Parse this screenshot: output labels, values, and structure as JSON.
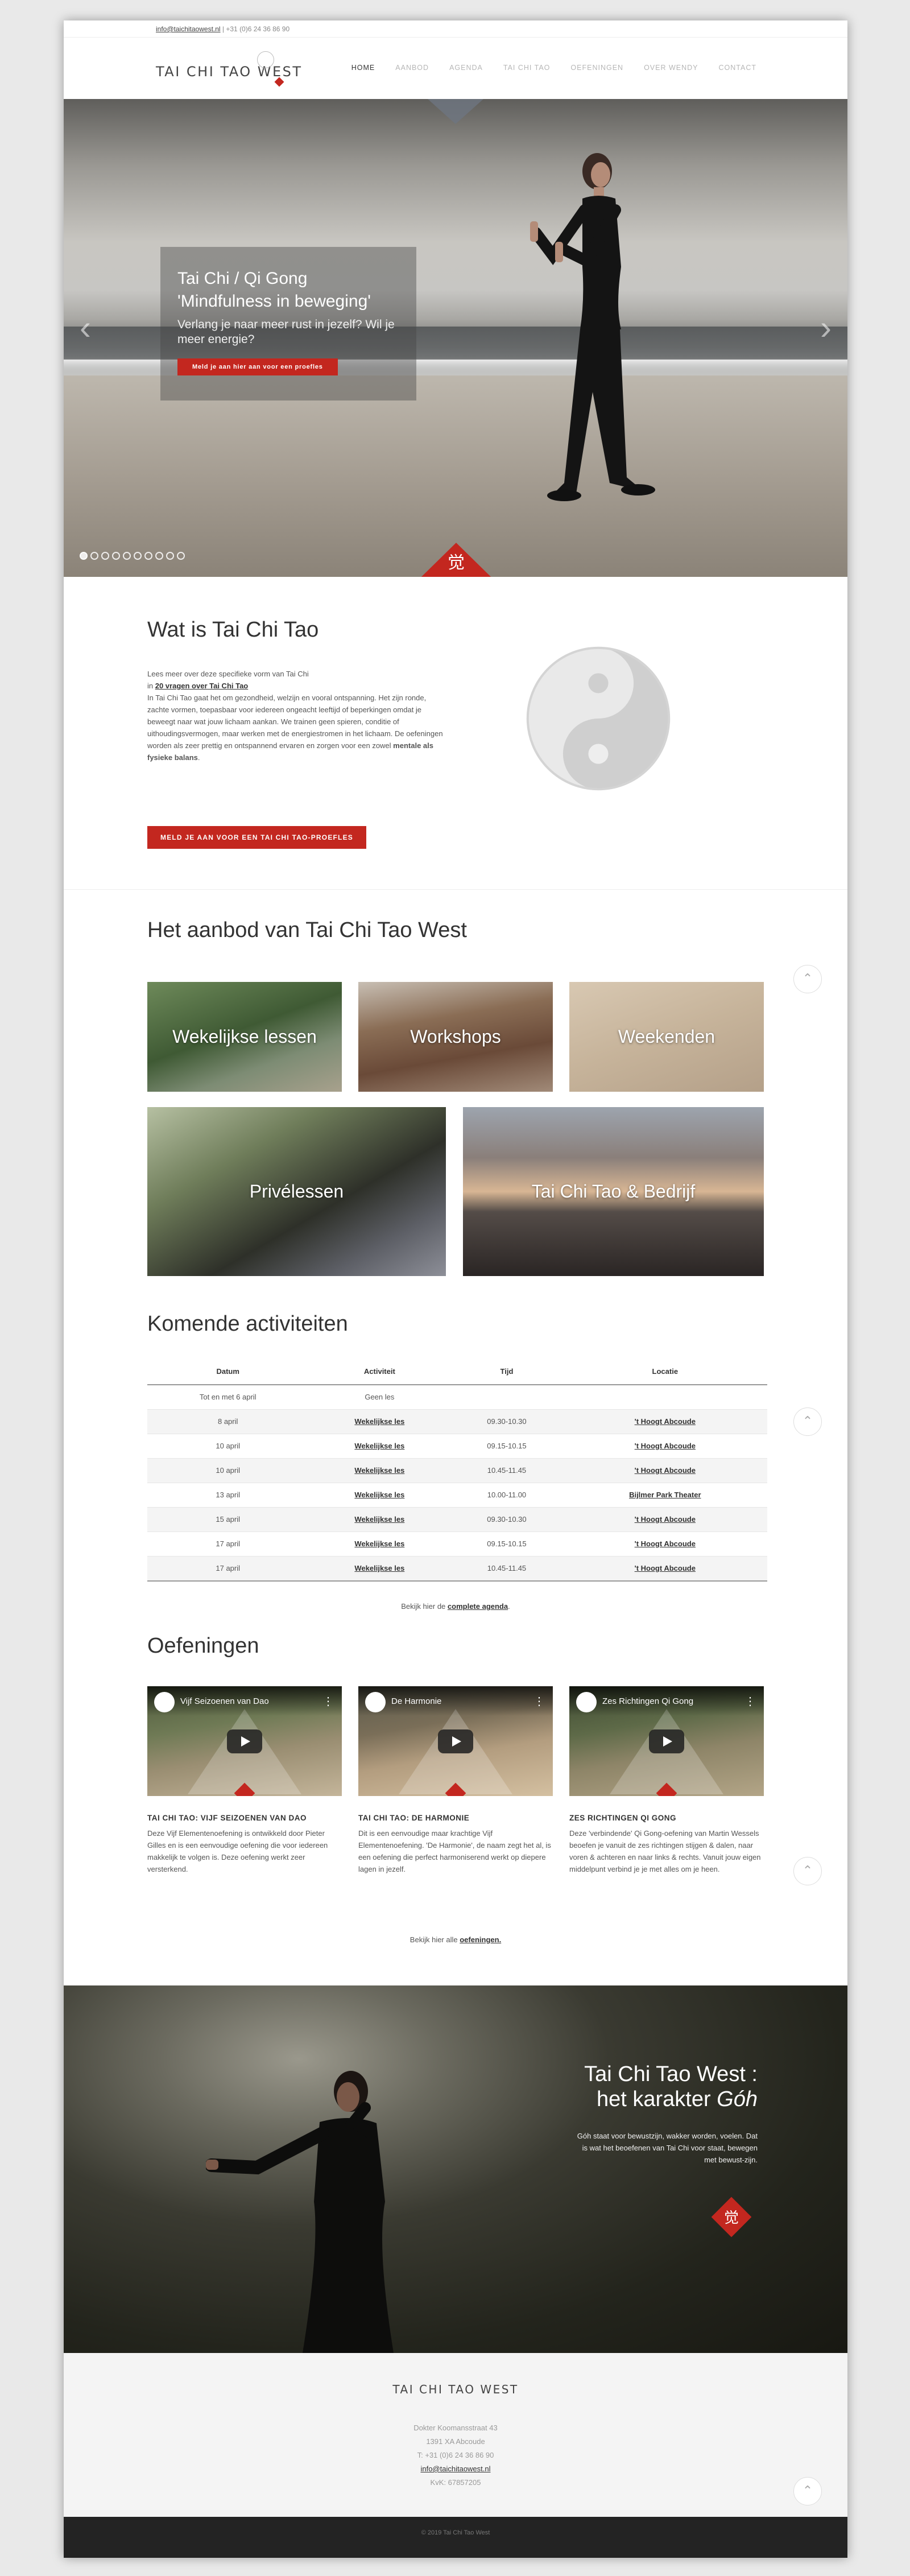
{
  "topbar": {
    "email": "info@taichitaowest.nl",
    "phone": "| +31 (0)6 24 36 86 90"
  },
  "header": {
    "logo_text": "TAI CHI TAO WEST",
    "nav": [
      "HOME",
      "AANBOD",
      "AGENDA",
      "TAI CHI TAO",
      "OEFENINGEN",
      "OVER WENDY",
      "CONTACT"
    ],
    "active_nav": "HOME"
  },
  "hero": {
    "caption_line1": "Tai Chi / Qi Gong",
    "caption_line2": "'Mindfulness in beweging'",
    "caption_sub": "Verlang je naar meer rust in jezelf? Wil je meer energie?",
    "button_label": "Meld je aan hier aan voor een proefles",
    "slide_count": 10,
    "active_slide": 0,
    "emblem_char": "觉",
    "prev_icon": "chevron-left-icon",
    "next_icon": "chevron-right-icon"
  },
  "intro": {
    "title": "Wat is Tai Chi Tao",
    "line1": "Lees meer over deze specifieke vorm van Tai Chi",
    "line2_pre": "in ",
    "line2_link": "20 vragen over Tai Chi Tao",
    "body": "In Tai Chi Tao gaat het om gezondheid, welzijn en vooral ontspanning. Het zijn ronde, zachte vormen, toepasbaar voor iedereen ongeacht leeftijd of beperkingen omdat je beweegt naar wat jouw lichaam aankan. We trainen geen spieren, conditie of uithoudingsvermogen, maar werken met de energiestromen in het lichaam. De oefeningen worden als zeer prettig en ontspannend ervaren en zorgen voor een zowel ",
    "body_bold": "mentale als fysieke balans",
    "body_end": ".",
    "button_label": "MELD JE AAN VOOR EEN TAI CHI TAO-PROEFLES"
  },
  "aanbod": {
    "title": "Het aanbod van Tai Chi Tao West",
    "tiles": [
      "Wekelijkse lessen",
      "Workshops",
      "Weekenden",
      "Privélessen",
      "Tai Chi Tao & Bedrijf"
    ]
  },
  "activiteiten": {
    "title": "Komende activiteiten",
    "columns": [
      "Datum",
      "Activiteit",
      "Tijd",
      "Locatie"
    ],
    "rows": [
      {
        "datum": "Tot en met 6 april",
        "activiteit": "Geen les",
        "tijd": "",
        "locatie": ""
      },
      {
        "datum": "8 april",
        "activiteit": "Wekelijkse les",
        "tijd": "09.30-10.30",
        "locatie": "'t Hoogt Abcoude"
      },
      {
        "datum": "10 april",
        "activiteit": "Wekelijkse les",
        "tijd": "09.15-10.15",
        "locatie": "'t Hoogt Abcoude"
      },
      {
        "datum": "10 april",
        "activiteit": "Wekelijkse les",
        "tijd": "10.45-11.45",
        "locatie": "'t Hoogt Abcoude"
      },
      {
        "datum": "13 april",
        "activiteit": "Wekelijkse les",
        "tijd": "10.00-11.00",
        "locatie": "Bijlmer Park Theater"
      },
      {
        "datum": "15 april",
        "activiteit": "Wekelijkse les",
        "tijd": "09.30-10.30",
        "locatie": "'t Hoogt Abcoude"
      },
      {
        "datum": "17 april",
        "activiteit": "Wekelijkse les",
        "tijd": "09.15-10.15",
        "locatie": "'t Hoogt Abcoude"
      },
      {
        "datum": "17 april",
        "activiteit": "Wekelijkse les",
        "tijd": "10.45-11.45",
        "locatie": "'t Hoogt Abcoude"
      }
    ],
    "footer_pre": "Bekijk hier de ",
    "footer_link": "complete agenda",
    "footer_end": "."
  },
  "oefeningen": {
    "title": "Oefeningen",
    "videos": [
      {
        "video_title": "Vijf Seizoenen van Dao",
        "heading": "TAI CHI TAO: VIJF SEIZOENEN VAN DAO",
        "text": "Deze Vijf Elementenoefening is ontwikkeld door Pieter Gilles en is een eenvoudige oefening die voor iedereen makkelijk te volgen is. Deze oefening werkt zeer versterkend."
      },
      {
        "video_title": "De Harmonie",
        "heading": "TAI CHI TAO: DE HARMONIE",
        "text": "Dit is een eenvoudige maar krachtige Vijf Elementenoefening. 'De Harmonie', de naam zegt het al, is een oefening die perfect harmoniserend werkt op diepere lagen in jezelf."
      },
      {
        "video_title": "Zes Richtingen Qi Gong",
        "heading": "ZES RICHTINGEN QI GONG",
        "text": "Deze 'verbindende' Qi Gong-oefening van Martin Wessels beoefen je vanuit de zes richtingen stijgen & dalen, naar voren & achteren en naar links & rechts. Vanuit jouw eigen middelpunt verbind je je met alles om je heen."
      }
    ],
    "footer_pre": "Bekijk hier alle ",
    "footer_link": "oefeningen."
  },
  "karakter": {
    "title_line1": "Tai Chi Tao West :",
    "title_line2_pre": "het karakter ",
    "title_line2_em": "Góh",
    "text": "Góh staat voor bewustzijn, wakker worden, voelen. Dat is wat het beoefenen van Tai Chi voor staat, bewegen met bewust-zijn.",
    "emblem_char": "觉"
  },
  "footer": {
    "logo_text": "TAI CHI TAO WEST",
    "address1": "Dokter Koomansstraat 43",
    "address2": "1391 XA Abcoude",
    "phone": "T: +31 (0)6 24 36 86 90",
    "email": "info@taichitaowest.nl",
    "kvk": "KvK: 67857205",
    "copyright": "© 2019 Tai Chi Tao West"
  },
  "colors": {
    "accent": "#c3271f",
    "footer_bg": "#f4f4f4",
    "copybar_bg": "#232323"
  }
}
